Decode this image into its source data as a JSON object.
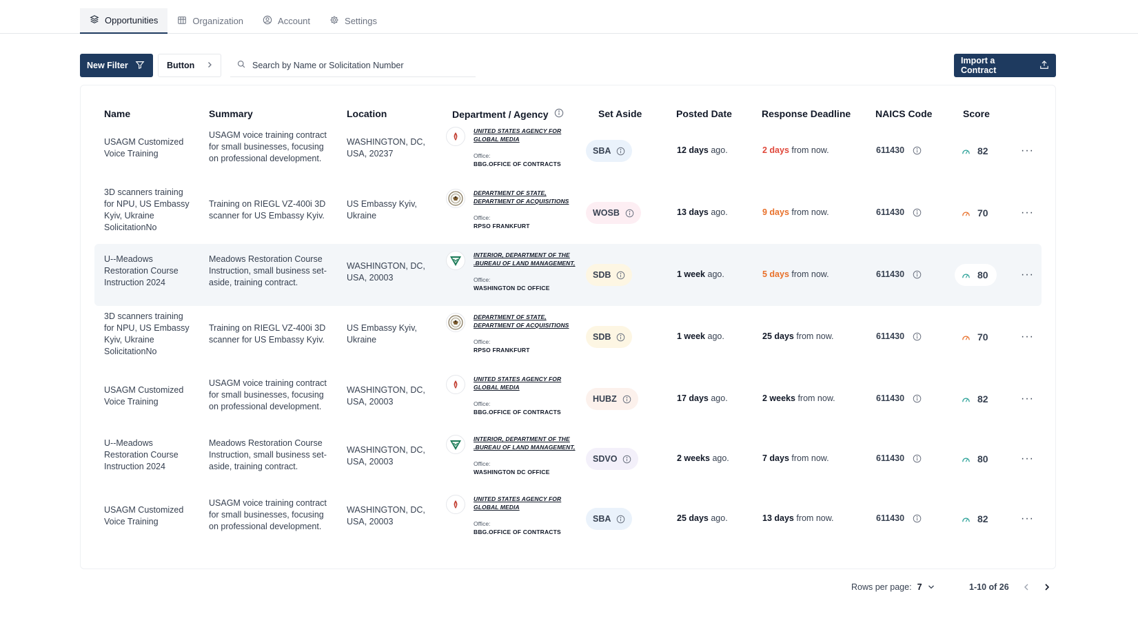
{
  "tabs": [
    {
      "label": "Opportunities",
      "icon": "layers-icon",
      "active": true
    },
    {
      "label": "Organization",
      "icon": "building-icon",
      "active": false
    },
    {
      "label": "Account",
      "icon": "user-circle-icon",
      "active": false
    },
    {
      "label": "Settings",
      "icon": "gear-icon",
      "active": false
    }
  ],
  "toolbar": {
    "new_filter_label": "New Filter",
    "button_label": "Button",
    "search_placeholder": "Search by Name or Solicitation Number",
    "import_label": "Import a Contract"
  },
  "table": {
    "headers": {
      "name": "Name",
      "summary": "Summary",
      "location": "Location",
      "department": "Department / Agency",
      "set_aside": "Set Aside",
      "posted": "Posted Date",
      "deadline": "Response Deadline",
      "naics": "NAICS Code",
      "score": "Score"
    },
    "office_label": "Office:",
    "rows": [
      {
        "name": "USAGM Customized Voice Training",
        "summary": "USAGM voice training contract for small businesses, focusing on professional development.",
        "location": "WASHINGTON, DC, USA, 20237",
        "agency": "UNITED STATES AGENCY FOR GLOBAL MEDIA",
        "logo": "usagm-logo-icon",
        "office": "BBG.OFFICE OF CONTRACTS",
        "set_aside": "SBA",
        "set_aside_color": "#eaf2fb",
        "posted_value": "12 days",
        "posted_suffix": " ago.",
        "deadline_value": "2 days",
        "deadline_suffix": " from now.",
        "deadline_urgent": "red",
        "naics": "611430",
        "score": "82",
        "score_color": "#2aa198"
      },
      {
        "name": "3D scanners training for NPU, US Embassy Kyiv, Ukraine SolicitationNo",
        "summary": "Training on RIEGL VZ-400i 3D scanner for US Embassy Kyiv.",
        "location": "US Embassy Kyiv, Ukraine",
        "agency": "DEPARTMENT OF STATE, DEPARTMENT OF ACQUISITIONS",
        "logo": "state-seal-icon",
        "office": "RPSO FRANKFURT",
        "set_aside": "WOSB",
        "set_aside_color": "#fdeef3",
        "posted_value": "13 days",
        "posted_suffix": " ago.",
        "deadline_value": "9 days",
        "deadline_suffix": " from now.",
        "deadline_urgent": "orange",
        "naics": "611430",
        "score": "70",
        "score_color": "#e8702a"
      },
      {
        "name": "U--Meadows Restoration Course Instruction 2024",
        "summary": "Meadows Restoration Course Instruction, small business set-aside, training contract.",
        "location": "WASHINGTON, DC, USA, 20003",
        "agency": "INTERIOR, DEPARTMENT OF THE .BUREAU OF LAND MANAGEMENT,",
        "logo": "blm-logo-icon",
        "office": "WASHINGTON DC OFFICE",
        "set_aside": "SDB",
        "set_aside_color": "#fdf6e3",
        "posted_value": "1 week",
        "posted_suffix": " ago.",
        "deadline_value": "5 days",
        "deadline_suffix": " from now.",
        "deadline_urgent": "orange",
        "naics": "611430",
        "score": "80",
        "score_color": "#2aa198",
        "highlighted": true
      },
      {
        "name": "3D scanners training for NPU, US Embassy Kyiv, Ukraine SolicitationNo",
        "summary": "Training on RIEGL VZ-400i 3D scanner for US Embassy Kyiv.",
        "location": "US Embassy Kyiv, Ukraine",
        "agency": "DEPARTMENT OF STATE, DEPARTMENT OF ACQUISITIONS",
        "logo": "state-seal-icon",
        "office": "RPSO FRANKFURT",
        "set_aside": "SDB",
        "set_aside_color": "#fdf6e3",
        "posted_value": "1 week",
        "posted_suffix": " ago.",
        "deadline_value": "25 days",
        "deadline_suffix": " from now.",
        "deadline_urgent": "none",
        "naics": "611430",
        "score": "70",
        "score_color": "#e8702a"
      },
      {
        "name": "USAGM Customized Voice Training",
        "summary": "USAGM voice training contract for small businesses, focusing on professional development.",
        "location": "WASHINGTON, DC, USA, 20003",
        "agency": "UNITED STATES AGENCY FOR GLOBAL MEDIA",
        "logo": "usagm-logo-icon",
        "office": "BBG.OFFICE OF CONTRACTS",
        "set_aside": "HUBZ",
        "set_aside_color": "#fcf1ec",
        "posted_value": "17 days",
        "posted_suffix": " ago.",
        "deadline_value": "2 weeks",
        "deadline_suffix": " from now.",
        "deadline_urgent": "none",
        "naics": "611430",
        "score": "82",
        "score_color": "#2aa198"
      },
      {
        "name": "U--Meadows Restoration Course Instruction 2024",
        "summary": "Meadows Restoration Course Instruction, small business set-aside, training contract.",
        "location": "WASHINGTON, DC, USA, 20003",
        "agency": "INTERIOR, DEPARTMENT OF THE .BUREAU OF LAND MANAGEMENT,",
        "logo": "blm-logo-icon",
        "office": "WASHINGTON DC OFFICE",
        "set_aside": "SDVO",
        "set_aside_color": "#f3f0fa",
        "posted_value": "2 weeks",
        "posted_suffix": " ago.",
        "deadline_value": "7 days",
        "deadline_suffix": " from now.",
        "deadline_urgent": "none",
        "naics": "611430",
        "score": "80",
        "score_color": "#2aa198"
      },
      {
        "name": "USAGM Customized Voice Training",
        "summary": "USAGM voice training contract for small businesses, focusing on professional development.",
        "location": "WASHINGTON, DC, USA, 20003",
        "agency": "UNITED STATES AGENCY FOR GLOBAL MEDIA",
        "logo": "usagm-logo-icon",
        "office": "BBG.OFFICE OF CONTRACTS",
        "set_aside": "SBA",
        "set_aside_color": "#eaf2fb",
        "posted_value": "25 days",
        "posted_suffix": " ago.",
        "deadline_value": "13 days",
        "deadline_suffix": " from now.",
        "deadline_urgent": "none",
        "naics": "611430",
        "score": "82",
        "score_color": "#2aa198"
      }
    ]
  },
  "pagination": {
    "rows_per_page_label": "Rows per page:",
    "rows_per_page_value": "7",
    "range": "1-10 of 26"
  },
  "colors": {
    "primary": "#1e3a5f",
    "warning": "#e8702a",
    "urgent": "#e0483b",
    "score_good": "#2aa198"
  }
}
